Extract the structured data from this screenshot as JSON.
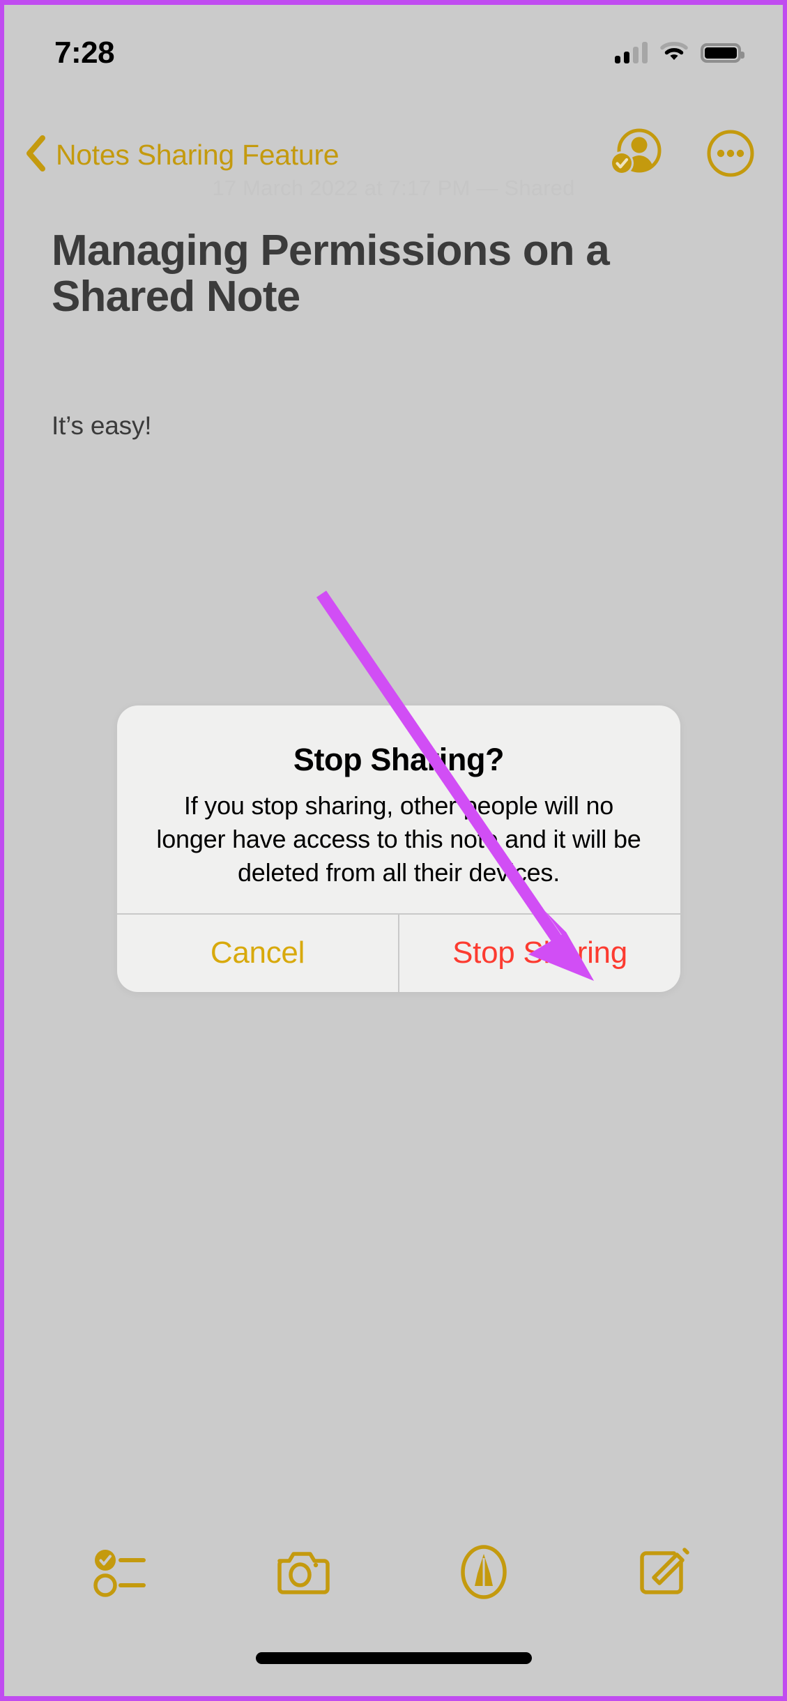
{
  "status_bar": {
    "time": "7:28",
    "icons": {
      "cellular": "signal-bars-icon",
      "wifi": "wifi-icon",
      "battery": "battery-icon"
    }
  },
  "nav_bar": {
    "back_label": "Notes Sharing Feature",
    "back_icon": "chevron-left-icon",
    "shared_icon": "shared-person-check-icon",
    "more_icon": "more-circle-icon"
  },
  "note": {
    "date_line": "17 March 2022 at 7:17 PM — Shared",
    "title": "Managing Permissions on a Shared Note",
    "body": "It’s easy!"
  },
  "alert": {
    "title": "Stop Sharing?",
    "message": "If you stop sharing, other people will no longer have access to this note and it will be deleted from all their devices.",
    "cancel_label": "Cancel",
    "confirm_label": "Stop Sharing"
  },
  "toolbar": {
    "items": [
      {
        "name": "checklist-icon",
        "label": "Checklist"
      },
      {
        "name": "camera-icon",
        "label": "Camera"
      },
      {
        "name": "markup-pen-icon",
        "label": "Markup"
      },
      {
        "name": "compose-icon",
        "label": "Compose"
      }
    ]
  },
  "annotation": {
    "type": "arrow",
    "color": "#d14ef5",
    "points_to": "Stop Sharing"
  },
  "colors": {
    "accent": "#c49a0e",
    "destructive": "#fc3b30",
    "page_background": "#cbcbcb",
    "dialog_background": "#f0f0ef",
    "frame_highlight": "#c04cf0"
  }
}
